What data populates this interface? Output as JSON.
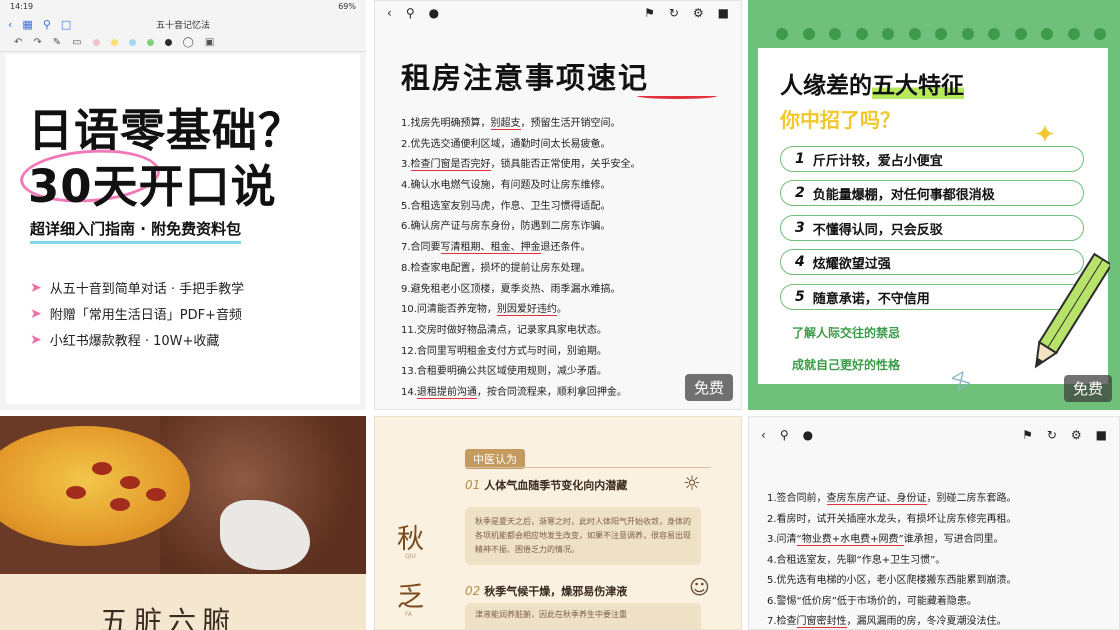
{
  "card1": {
    "status_time": "14:19",
    "status_right": "69%",
    "doc_title": "五十音记忆法",
    "title_line1": "日语零基础？",
    "title_line2": "30天开口说",
    "subtitle": "超详细入门指南 · 附免费资料包",
    "bullets": [
      "从五十音到简单对话 · 手把手教学",
      "附赠「常用生活日语」PDF+音频",
      "小红书爆款教程 · 10W+收藏"
    ],
    "pen_colors": [
      "#f5c0c8",
      "#f7e27a",
      "#a7d8f2",
      "#7ed07e",
      "#2b2b2b"
    ]
  },
  "card2": {
    "title": "租房注意事项速记",
    "badge": "免费",
    "items": [
      {
        "pre": "1.找房先明确预算，",
        "u": "别超支",
        "post": "，预留生活开销空间。"
      },
      {
        "pre": "2.优先选交通便利区域，通勤时间太长易疲惫。",
        "u": "",
        "post": ""
      },
      {
        "pre": "3.",
        "u": "检查门窗是否完好",
        "post": "，锁具能否正常使用，关乎安全。"
      },
      {
        "pre": "4.确认水电燃气设施，有问题及时让房东维修。",
        "u": "",
        "post": ""
      },
      {
        "pre": "5.合租选室友别马虎，作息、卫生习惯得适配。",
        "u": "",
        "post": ""
      },
      {
        "pre": "6.确认房产证与房东身份，防遇到二房东诈骗。",
        "u": "",
        "post": ""
      },
      {
        "pre": "7.合同要",
        "u": "写清租期、租金、押金",
        "post": "退还条件。"
      },
      {
        "pre": "8.检查家电配置，损坏的提前让房东处理。",
        "u": "",
        "post": ""
      },
      {
        "pre": "9.避免租老小区顶楼，夏季炎热、雨季漏水难搞。",
        "u": "",
        "post": ""
      },
      {
        "pre": "10.问清能否养宠物，",
        "u": "别因爱好违约",
        "post": "。"
      },
      {
        "pre": "11.交房时做好物品清点，记录家具家电状态。",
        "u": "",
        "post": ""
      },
      {
        "pre": "12.合同里写明租金支付方式与时间，别逾期。",
        "u": "",
        "post": ""
      },
      {
        "pre": "13.合租要明确公共区域使用规则，减少矛盾。",
        "u": "",
        "post": ""
      },
      {
        "pre": "14.",
        "u": "退租提前沟通",
        "post": "，按合同流程来，顺利拿回押金。"
      }
    ]
  },
  "card3": {
    "title_pre": "人缘差的",
    "title_hl": "五大特征",
    "subtitle": "你中招了吗？",
    "badge": "免费",
    "items": [
      {
        "n": "1",
        "text": "斤斤计较，爱占小便宜"
      },
      {
        "n": "2",
        "text": "负能量爆棚，对任何事都很消极"
      },
      {
        "n": "3",
        "text": "不懂得认同，只会反驳"
      },
      {
        "n": "4",
        "text": "炫耀欲望过强"
      },
      {
        "n": "5",
        "text": "随意承诺，不守信用"
      }
    ],
    "links": [
      "了解人际交往的禁忌",
      "成就自己更好的性格"
    ]
  },
  "card4": {
    "title": "五脏六腑"
  },
  "card5": {
    "tag": "中医认为",
    "sec1_num": "01",
    "sec1": "人体气血随季节变化向内潜藏",
    "box1": "秋季是夏天之后，渐寒之时，此时人体阳气开始收敛，身体的各项机能都会相应地发生改变，如果不注意调养，很容易出现精神不振、困倦乏力的情况。",
    "sec2_num": "02",
    "sec2": "秋季气候干燥，燥邪易伤津液",
    "box2": "津液能润养脏腑，因此在秋季养生中要注重",
    "vert1": "秋",
    "vert1_sub": "QIU",
    "vert2": "乏",
    "vert2_sub": "FA"
  },
  "card6": {
    "items": [
      {
        "pre": "1.签合同前，",
        "u": "查房东房产证、身份证",
        "post": "，别碰二房东套路。"
      },
      {
        "pre": "2.看房时，试开关插座水龙头，有损坏让房东修完再租。",
        "u": "",
        "post": ""
      },
      {
        "pre": "3.问清",
        "u": "“物业费+水电费+网费”",
        "post": "谁承担，写进合同里。"
      },
      {
        "pre": "4.合租选室友，先聊“作息+卫生习惯”。",
        "u": "",
        "post": ""
      },
      {
        "pre": "5.优先选有电梯的小区，老小区爬楼搬东西能累到崩溃。",
        "u": "",
        "post": ""
      },
      {
        "pre": "6.警惕“低价房”低于市场价的，可能藏着隐患。",
        "u": "",
        "post": ""
      },
      {
        "pre": "7.检查",
        "u": "门窗密封性",
        "post": "，漏风漏雨的房，冬冷夏潮没法住。"
      }
    ]
  }
}
